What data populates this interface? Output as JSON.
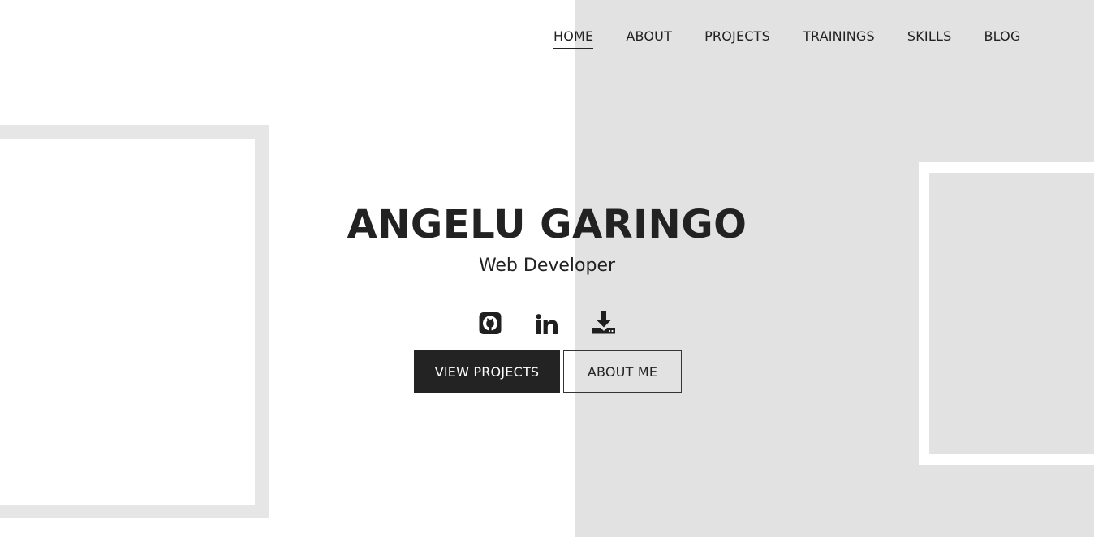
{
  "nav": {
    "items": [
      {
        "label": "HOME",
        "active": true
      },
      {
        "label": "ABOUT",
        "active": false
      },
      {
        "label": "PROJECTS",
        "active": false
      },
      {
        "label": "TRAININGS",
        "active": false
      },
      {
        "label": "SKILLS",
        "active": false
      },
      {
        "label": "BLOG",
        "active": false
      }
    ]
  },
  "hero": {
    "name": "ANGELU GARINGO",
    "role": "Web Developer"
  },
  "social": {
    "icons": [
      "github-icon",
      "linkedin-icon",
      "download-icon"
    ]
  },
  "buttons": {
    "view_projects": "VIEW PROJECTS",
    "about_me": "ABOUT ME"
  },
  "colors": {
    "background": "#ffffff",
    "panel": "#e2e2e2",
    "frame": "#e6e6e6",
    "text": "#222222",
    "button_dark": "#232323"
  }
}
